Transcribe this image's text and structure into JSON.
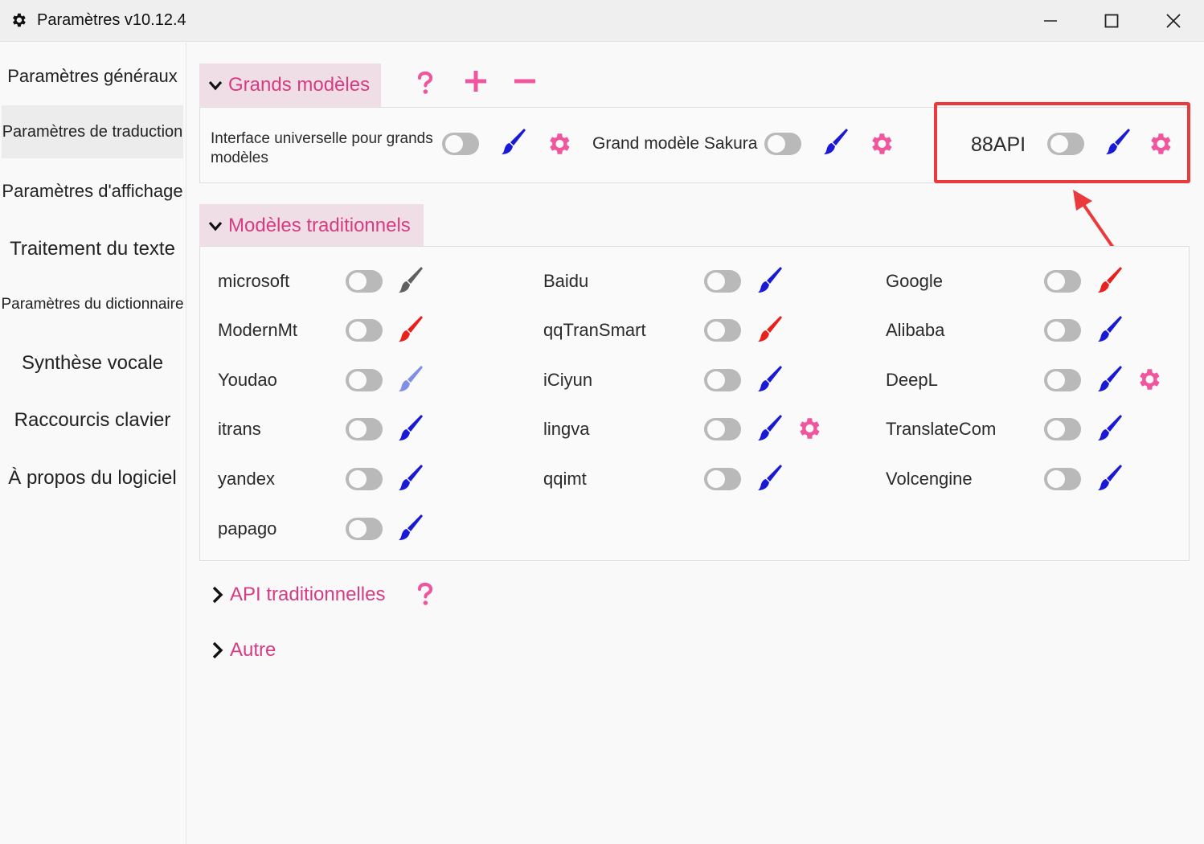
{
  "window": {
    "title": "Paramètres v10.12.4"
  },
  "sidebar": {
    "items": [
      {
        "label": "Paramètres généraux"
      },
      {
        "label": "Paramètres de traduction"
      },
      {
        "label": "Paramètres d'affichage"
      },
      {
        "label": "Traitement du texte"
      },
      {
        "label": "Paramètres du dictionnaire"
      },
      {
        "label": "Synthèse vocale"
      },
      {
        "label": "Raccourcis clavier"
      },
      {
        "label": "À propos du logiciel"
      }
    ],
    "active_index": 1
  },
  "large_models": {
    "title": "Grands modèles",
    "items": [
      {
        "label": "Interface universelle pour grands modèles",
        "enabled": false,
        "brush_color": "#1a1ad6"
      },
      {
        "label": "Grand modèle Sakura",
        "enabled": false,
        "brush_color": "#1a1ad6"
      },
      {
        "label": "88API",
        "enabled": false,
        "brush_color": "#1a1ad6"
      }
    ]
  },
  "traditional_models": {
    "title": "Modèles traditionnels",
    "items": [
      {
        "label": "microsoft",
        "brush_color": "#606060",
        "has_settings": false
      },
      {
        "label": "Baidu",
        "brush_color": "#1a1ad6",
        "has_settings": false
      },
      {
        "label": "Google",
        "brush_color": "#e8201e",
        "has_settings": false
      },
      {
        "label": "ModernMt",
        "brush_color": "#e8201e",
        "has_settings": false
      },
      {
        "label": "qqTranSmart",
        "brush_color": "#e8201e",
        "has_settings": false
      },
      {
        "label": "Alibaba",
        "brush_color": "#1a1ad6",
        "has_settings": false
      },
      {
        "label": "Youdao",
        "brush_color": "#7f8fe6",
        "has_settings": false
      },
      {
        "label": "iCiyun",
        "brush_color": "#1a1ad6",
        "has_settings": false
      },
      {
        "label": "DeepL",
        "brush_color": "#1a1ad6",
        "has_settings": true
      },
      {
        "label": "itrans",
        "brush_color": "#1a1ad6",
        "has_settings": false
      },
      {
        "label": "lingva",
        "brush_color": "#1a1ad6",
        "has_settings": true
      },
      {
        "label": "TranslateCom",
        "brush_color": "#1a1ad6",
        "has_settings": false
      },
      {
        "label": "yandex",
        "brush_color": "#1a1ad6",
        "has_settings": false
      },
      {
        "label": "qqimt",
        "brush_color": "#1a1ad6",
        "has_settings": false
      },
      {
        "label": "Volcengine",
        "brush_color": "#1a1ad6",
        "has_settings": false
      },
      {
        "label": "papago",
        "brush_color": "#1a1ad6",
        "has_settings": false
      }
    ]
  },
  "collapsed_sections": [
    {
      "title": "API traditionnelles"
    },
    {
      "title": "Autre"
    }
  ],
  "colors": {
    "accent": "#d63c83",
    "pink_icon": "#f0569e",
    "section_bg": "#efdee5",
    "highlight": "#ea3a3c"
  }
}
